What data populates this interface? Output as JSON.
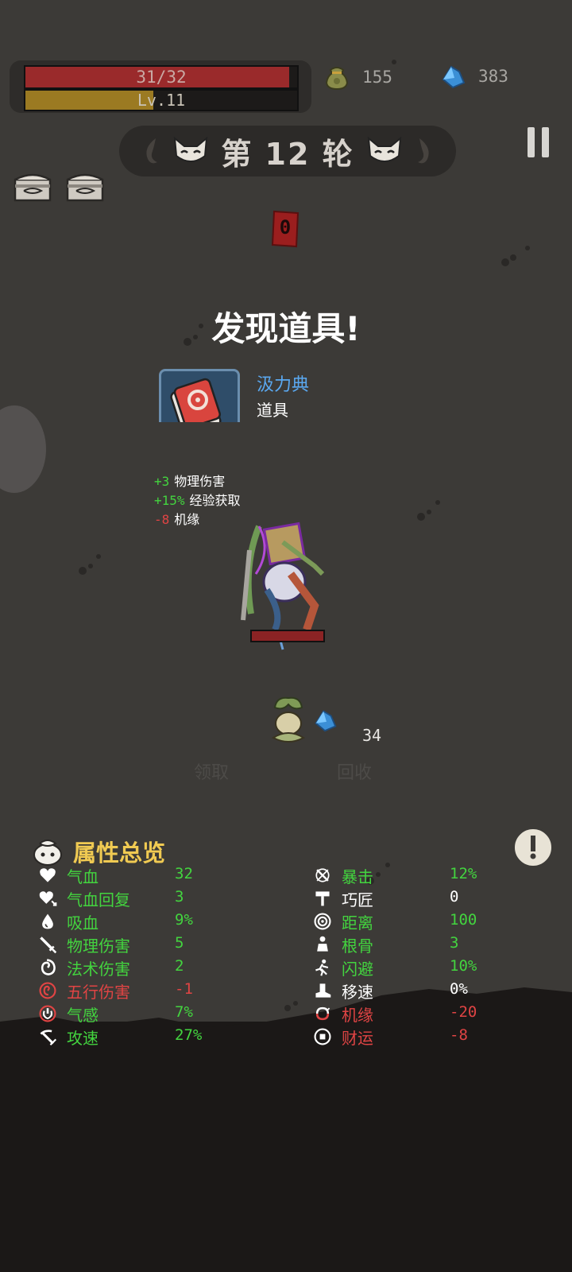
{
  "status": {
    "hp_text": "31/32",
    "hp_fraction": 0.97,
    "level_text": "Lv.11",
    "exp_fraction": 0.47
  },
  "currency": {
    "bag_value": "155",
    "crystal_value": "383"
  },
  "round": {
    "label": "第 12 轮"
  },
  "kill_counter": "0",
  "discovery": {
    "title": "发现道具!",
    "item_name": "汲力典",
    "item_type": "道具",
    "bonuses": [
      {
        "value": "+3",
        "name": "物理伤害",
        "tone": "g"
      },
      {
        "value": "+15%",
        "name": "经验获取",
        "tone": "g"
      },
      {
        "value": "-8",
        "name": "机缘",
        "tone": "r"
      }
    ],
    "claim_label": "领取",
    "recycle_label": "回收",
    "recycle_reward": "34"
  },
  "attributes": {
    "title": "属性总览",
    "left": [
      {
        "name": "气血",
        "value": "32",
        "tone": "g",
        "icon": "heart-icon"
      },
      {
        "name": "气血回复",
        "value": "3",
        "tone": "g",
        "icon": "heart-regen-icon"
      },
      {
        "name": "吸血",
        "value": "9%",
        "tone": "g",
        "icon": "blood-drop-icon"
      },
      {
        "name": "物理伤害",
        "value": "5",
        "tone": "g",
        "icon": "sword-icon"
      },
      {
        "name": "法术伤害",
        "value": "2",
        "tone": "g",
        "icon": "spiral-icon"
      },
      {
        "name": "五行伤害",
        "value": "-1",
        "tone": "r",
        "icon": "elements-icon"
      },
      {
        "name": "气感",
        "value": "7%",
        "tone": "g",
        "icon": "qi-icon"
      },
      {
        "name": "攻速",
        "value": "27%",
        "tone": "g",
        "icon": "attack-speed-icon"
      }
    ],
    "right": [
      {
        "name": "暴击",
        "value": "12%",
        "tone": "g",
        "icon": "crit-icon"
      },
      {
        "name": "巧匠",
        "value": "0",
        "tone": "w",
        "icon": "hammer-icon"
      },
      {
        "name": "距离",
        "value": "100",
        "tone": "g",
        "icon": "range-icon"
      },
      {
        "name": "根骨",
        "value": "3",
        "tone": "g",
        "icon": "constitution-icon"
      },
      {
        "name": "闪避",
        "value": "10%",
        "tone": "g",
        "icon": "dodge-icon"
      },
      {
        "name": "移速",
        "value": "0%",
        "tone": "w",
        "icon": "boot-icon"
      },
      {
        "name": "机缘",
        "value": "-20",
        "tone": "r",
        "icon": "luck-icon"
      },
      {
        "name": "财运",
        "value": "-8",
        "tone": "r",
        "icon": "fortune-icon"
      }
    ]
  }
}
